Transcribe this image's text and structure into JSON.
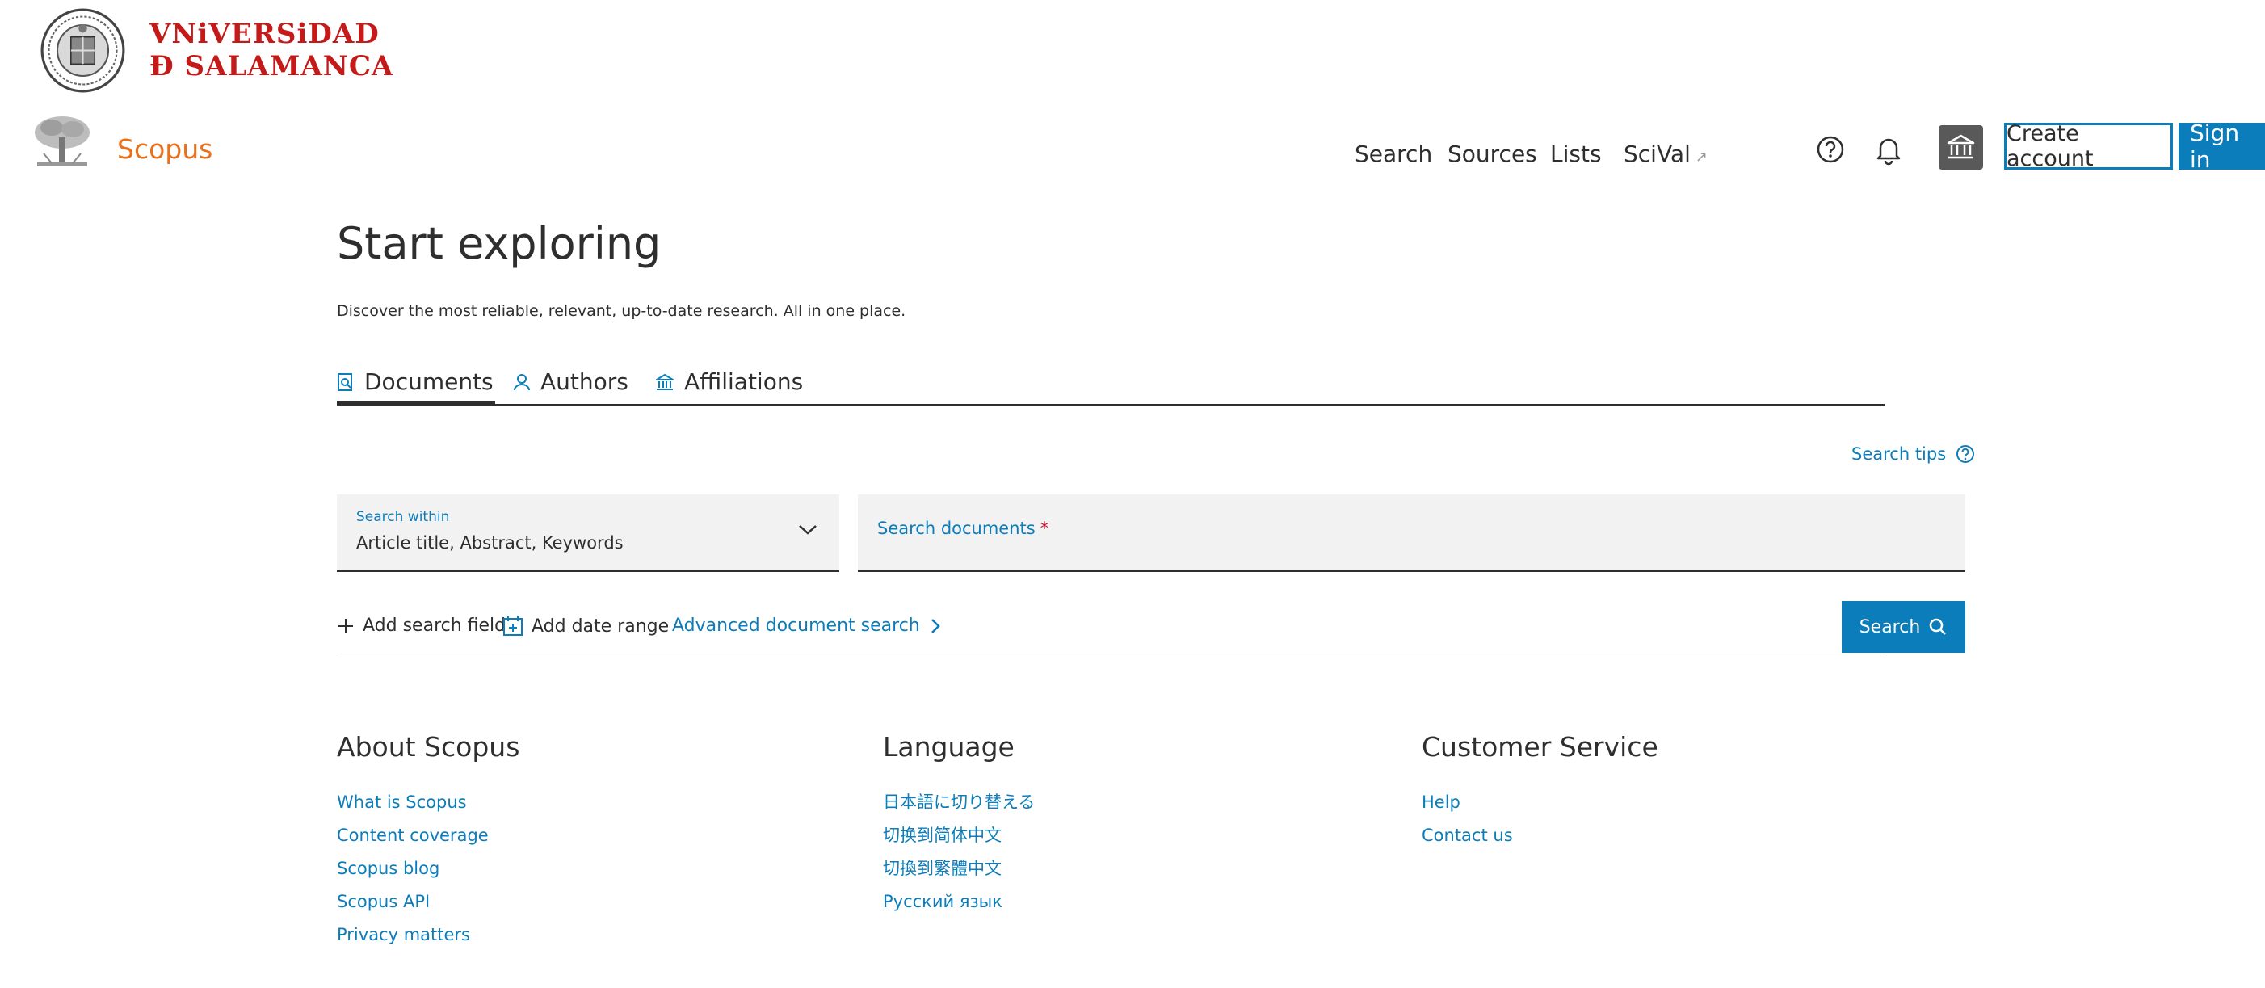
{
  "university": {
    "name_line1": "VNiVERSiDAD",
    "name_line2": "Ð SALAMANCA"
  },
  "header": {
    "brand": "Scopus",
    "nav": {
      "search": "Search",
      "sources": "Sources",
      "lists": "Lists",
      "scival": "SciVal",
      "scival_ext_icon": "↗"
    },
    "create_account": "Create account",
    "sign_in": "Sign in"
  },
  "main": {
    "title": "Start exploring",
    "subtitle": "Discover the most reliable, relevant, up-to-date research. All in one place.",
    "tabs": [
      {
        "label": "Documents",
        "icon": "document-search-icon",
        "active": true
      },
      {
        "label": "Authors",
        "icon": "person-icon",
        "active": false
      },
      {
        "label": "Affiliations",
        "icon": "institution-icon",
        "active": false
      }
    ],
    "search_tips": "Search tips",
    "search_within": {
      "label": "Search within",
      "value": "Article title, Abstract, Keywords"
    },
    "search_documents": {
      "placeholder": "Search documents",
      "required_mark": "*"
    },
    "add_search_field": "Add search field",
    "add_date_range": "Add date range",
    "advanced_search": "Advanced document search",
    "search_button": "Search"
  },
  "footer": {
    "about": {
      "title": "About Scopus",
      "links": [
        "What is Scopus",
        "Content coverage",
        "Scopus blog",
        "Scopus API",
        "Privacy matters"
      ]
    },
    "language": {
      "title": "Language",
      "links": [
        "日本語に切り替える",
        "切换到简体中文",
        "切換到繁體中文",
        "Русский язык"
      ]
    },
    "customer_service": {
      "title": "Customer Service",
      "links": [
        "Help",
        "Contact us"
      ]
    }
  },
  "colors": {
    "brand_orange": "#e9711c",
    "link_blue": "#0c7dbb",
    "university_red": "#c41a1a",
    "field_bg": "#f2f2f2"
  }
}
